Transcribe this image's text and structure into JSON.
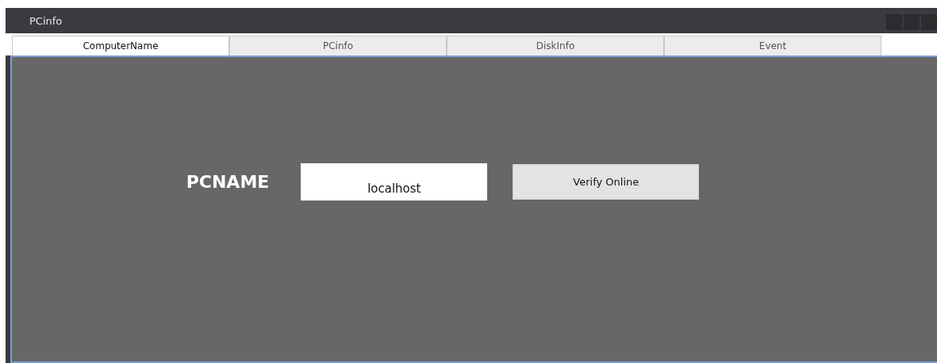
{
  "window": {
    "title": "PCinfo"
  },
  "tabs": [
    {
      "label": "ComputerName",
      "selected": true
    },
    {
      "label": "PCinfo",
      "selected": false
    },
    {
      "label": "DiskInfo",
      "selected": false
    },
    {
      "label": "Event",
      "selected": false
    }
  ],
  "form": {
    "label": "PCNAME",
    "value": "localhost",
    "button": "Verify Online"
  }
}
